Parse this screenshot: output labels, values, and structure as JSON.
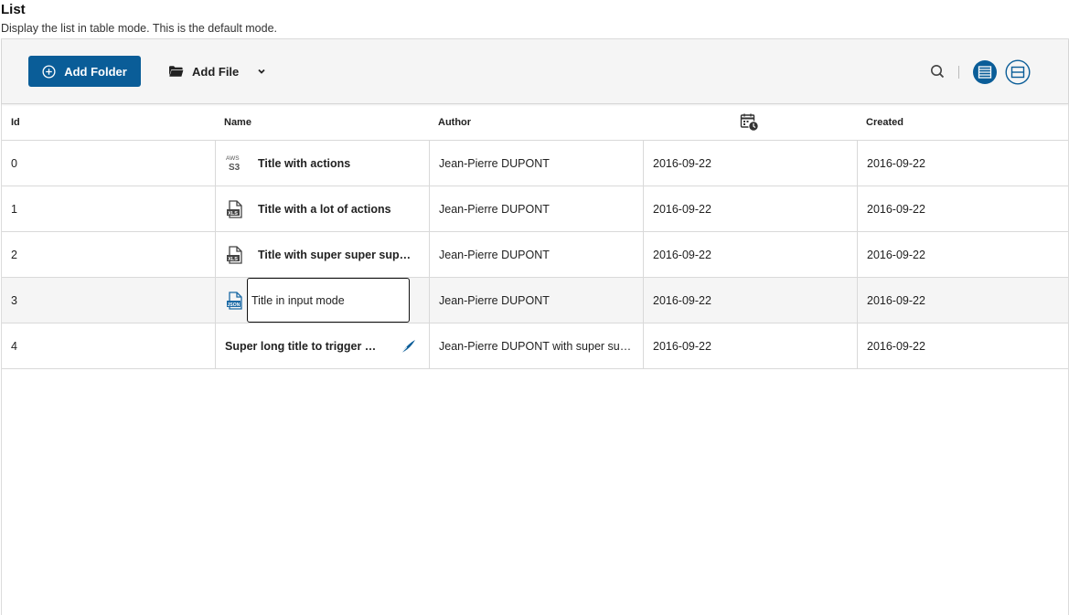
{
  "page": {
    "title": "List",
    "subtitle": "Display the list in table mode. This is the default mode."
  },
  "toolbar": {
    "add_folder_label": "Add Folder",
    "add_file_label": "Add File",
    "accent_color": "#0a5d98"
  },
  "table": {
    "headers": {
      "id": "Id",
      "name": "Name",
      "author": "Author",
      "date_icon": "calendar-clock-icon",
      "created": "Created"
    },
    "rows": [
      {
        "id": "0",
        "icon": "aws-s3-icon",
        "name": "Title with actions",
        "author": "Jean-Pierre DUPONT",
        "date": "2016-09-22",
        "created": "2016-09-22"
      },
      {
        "id": "1",
        "icon": "xls-file-icon",
        "name": "Title with a lot of actions",
        "author": "Jean-Pierre DUPONT",
        "date": "2016-09-22",
        "created": "2016-09-22"
      },
      {
        "id": "2",
        "icon": "xls-file-icon",
        "name": "Title with super super super long title",
        "author": "Jean-Pierre DUPONT",
        "date": "2016-09-22",
        "created": "2016-09-22"
      },
      {
        "id": "3",
        "icon": "json-file-icon",
        "name": "Title in input mode",
        "author": "Jean-Pierre DUPONT",
        "date": "2016-09-22",
        "created": "2016-09-22"
      },
      {
        "id": "4",
        "icon": "feather-icon",
        "name": "Super long title to trigger overflow",
        "author": "Jean-Pierre DUPONT with super super long text",
        "date": "2016-09-22",
        "created": "2016-09-22"
      }
    ]
  }
}
